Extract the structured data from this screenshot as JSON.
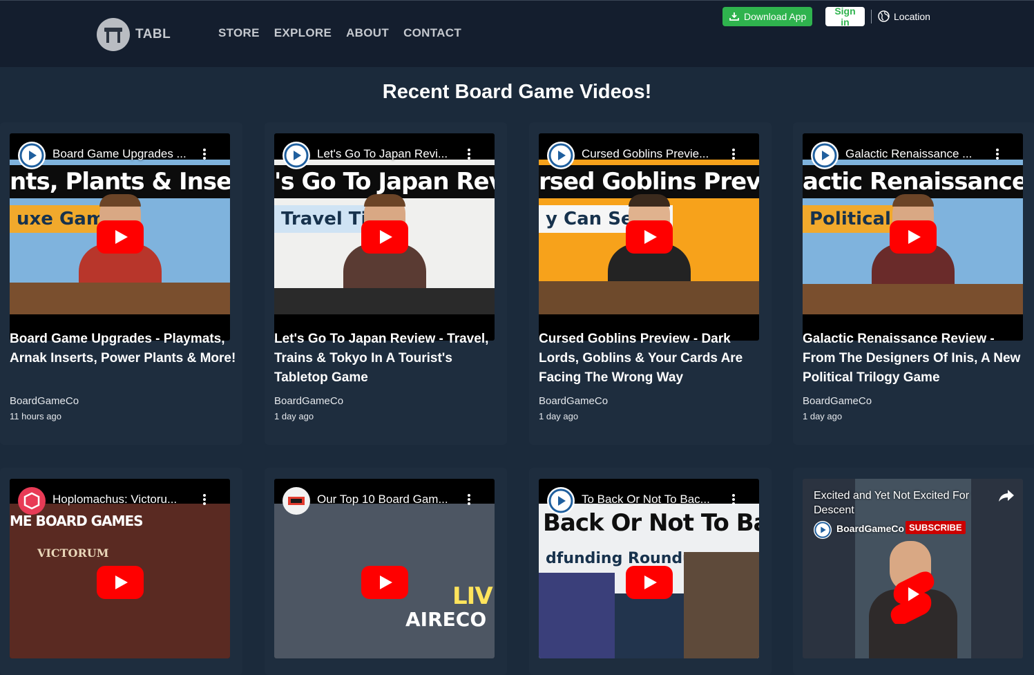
{
  "header": {
    "logo_text": "TABL",
    "nav": [
      "STORE",
      "EXPLORE",
      "ABOUT",
      "CONTACT"
    ],
    "download_label": "Download App",
    "signin_label": "Sign in",
    "location_label": "Location"
  },
  "page_title": "Recent Board Game Videos!",
  "colors": {
    "header_bg": "#141e2e",
    "page_bg": "#1b2a3b",
    "accent_green": "#2fb34e",
    "youtube_red": "#ff0000"
  },
  "videos": [
    {
      "player_title": "Board Game Upgrades ...",
      "banner": "nts, Plants & Inserts",
      "subbanner": "uxe Game",
      "title": "Board Game Upgrades - Playmats, Arnak Inserts, Power Plants & More!",
      "channel": "BoardGameCo",
      "time": "11 hours ago"
    },
    {
      "player_title": "Let's Go To Japan Revi...",
      "banner": "'s Go To Japan Review",
      "subbanner": "Travel Tip",
      "title": "Let's Go To Japan Review - Travel, Trains & Tokyo In A Tourist's Tabletop Game",
      "channel": "BoardGameCo",
      "time": "1 day ago"
    },
    {
      "player_title": "Cursed Goblins Previe...",
      "banner": "rsed Goblins Preview",
      "subbanner": "y Can See...",
      "title": "Cursed Goblins Preview - Dark Lords, Goblins & Your Cards Are Facing The Wrong Way",
      "channel": "BoardGameCo",
      "time": "1 day ago"
    },
    {
      "player_title": "Galactic Renaissance ...",
      "banner": "actic Renaissance Review",
      "subbanner": "Political Tri",
      "title": "Galactic Renaissance Review - From The Designers Of Inis, A New Political Trilogy Game",
      "channel": "BoardGameCo",
      "time": "1 day ago"
    },
    {
      "player_title": "Hoplomachus: Victoru...",
      "banner": "ME BOARD GAMES",
      "subbanner": "VICTORUM"
    },
    {
      "player_title": "Our Top 10 Board Gam...",
      "banner": "LIV",
      "subbanner": "AIRECO"
    },
    {
      "player_title": "To Back Or Not To Bac...",
      "banner": "Back Or Not To Back",
      "subbanner": "dfunding Roundup"
    },
    {
      "player_title": "Excited and Yet Not Excited For Descent",
      "channel_label": "BoardGameCo",
      "subscribe_label": "SUBSCRIBE"
    }
  ]
}
